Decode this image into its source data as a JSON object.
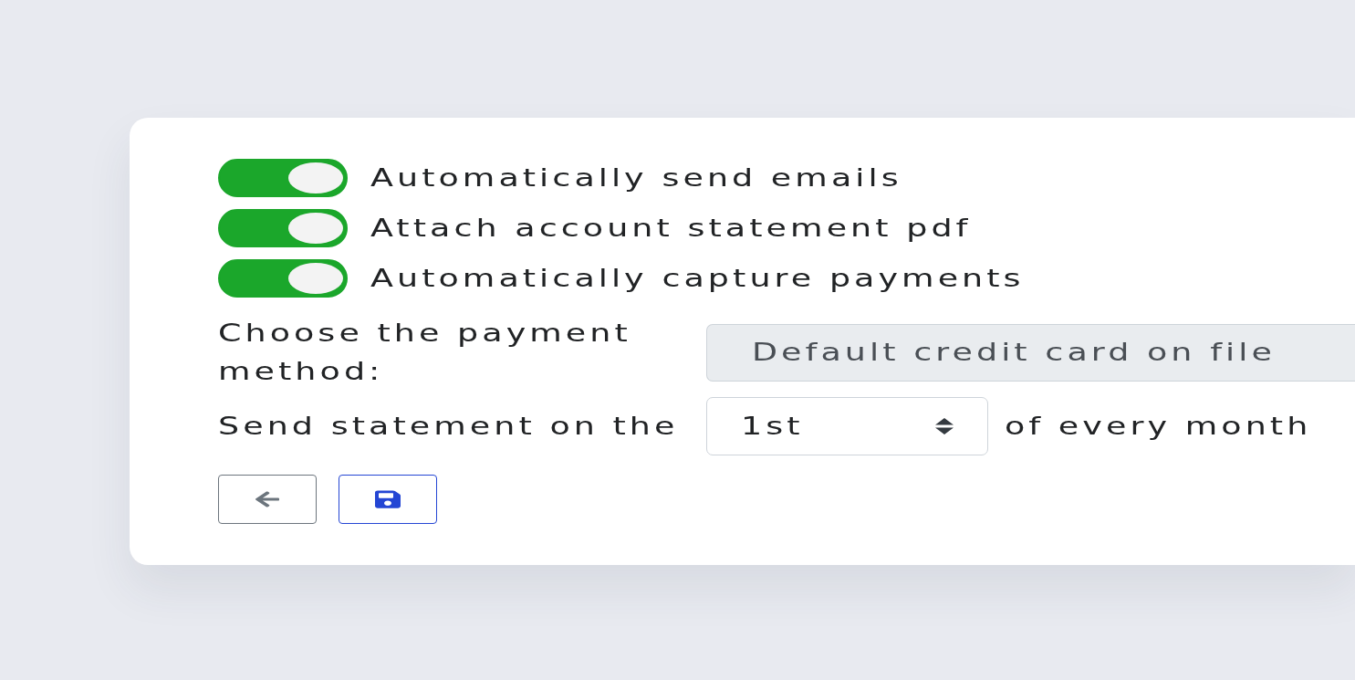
{
  "toggles": [
    {
      "label": "Automatically send emails",
      "on": true
    },
    {
      "label": "Attach account statement pdf",
      "on": true
    },
    {
      "label": "Automatically capture payments",
      "on": true
    }
  ],
  "payment_method": {
    "label": "Choose the payment method:",
    "value": "Default credit card on file",
    "disabled": true
  },
  "statement_day": {
    "label": "Send statement on the",
    "value": "1st",
    "suffix": "of every month"
  },
  "buttons": [
    {
      "kind": "back"
    },
    {
      "kind": "save"
    }
  ]
}
